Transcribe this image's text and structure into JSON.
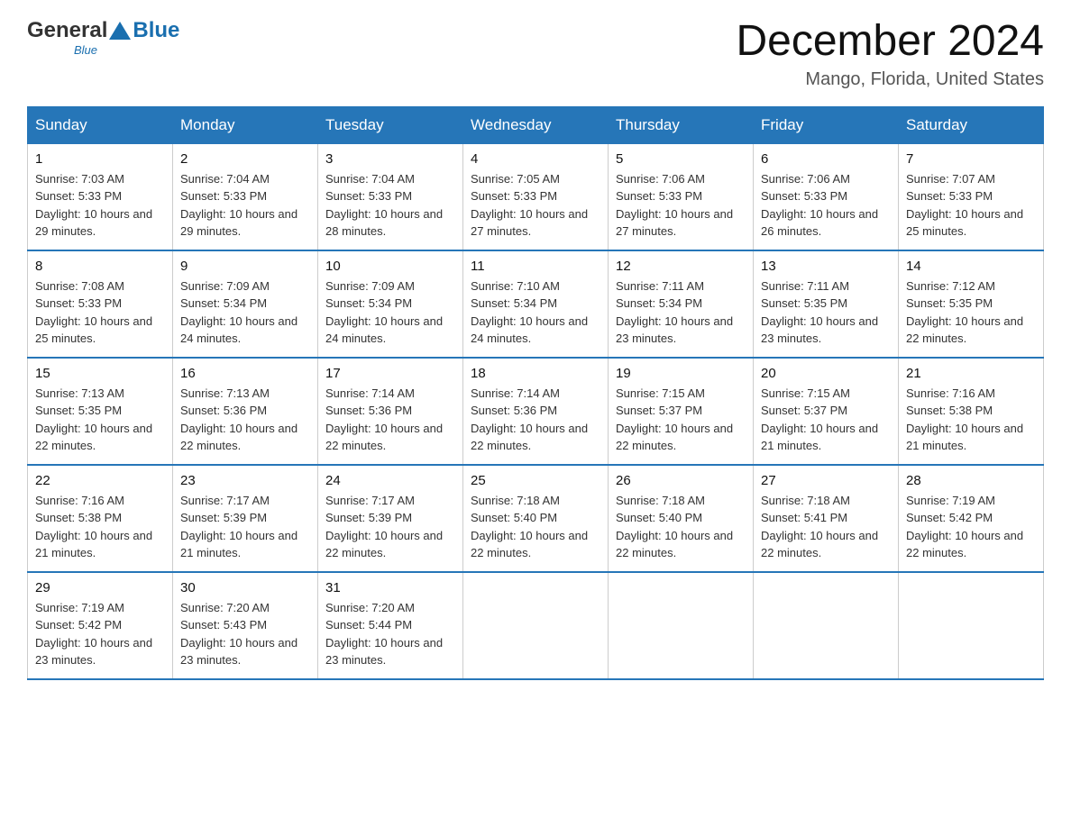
{
  "header": {
    "logo_general": "General",
    "logo_blue": "Blue",
    "month_title": "December 2024",
    "location": "Mango, Florida, United States"
  },
  "weekdays": [
    "Sunday",
    "Monday",
    "Tuesday",
    "Wednesday",
    "Thursday",
    "Friday",
    "Saturday"
  ],
  "weeks": [
    [
      {
        "day": "1",
        "sunrise": "7:03 AM",
        "sunset": "5:33 PM",
        "daylight": "10 hours and 29 minutes."
      },
      {
        "day": "2",
        "sunrise": "7:04 AM",
        "sunset": "5:33 PM",
        "daylight": "10 hours and 29 minutes."
      },
      {
        "day": "3",
        "sunrise": "7:04 AM",
        "sunset": "5:33 PM",
        "daylight": "10 hours and 28 minutes."
      },
      {
        "day": "4",
        "sunrise": "7:05 AM",
        "sunset": "5:33 PM",
        "daylight": "10 hours and 27 minutes."
      },
      {
        "day": "5",
        "sunrise": "7:06 AM",
        "sunset": "5:33 PM",
        "daylight": "10 hours and 27 minutes."
      },
      {
        "day": "6",
        "sunrise": "7:06 AM",
        "sunset": "5:33 PM",
        "daylight": "10 hours and 26 minutes."
      },
      {
        "day": "7",
        "sunrise": "7:07 AM",
        "sunset": "5:33 PM",
        "daylight": "10 hours and 25 minutes."
      }
    ],
    [
      {
        "day": "8",
        "sunrise": "7:08 AM",
        "sunset": "5:33 PM",
        "daylight": "10 hours and 25 minutes."
      },
      {
        "day": "9",
        "sunrise": "7:09 AM",
        "sunset": "5:34 PM",
        "daylight": "10 hours and 24 minutes."
      },
      {
        "day": "10",
        "sunrise": "7:09 AM",
        "sunset": "5:34 PM",
        "daylight": "10 hours and 24 minutes."
      },
      {
        "day": "11",
        "sunrise": "7:10 AM",
        "sunset": "5:34 PM",
        "daylight": "10 hours and 24 minutes."
      },
      {
        "day": "12",
        "sunrise": "7:11 AM",
        "sunset": "5:34 PM",
        "daylight": "10 hours and 23 minutes."
      },
      {
        "day": "13",
        "sunrise": "7:11 AM",
        "sunset": "5:35 PM",
        "daylight": "10 hours and 23 minutes."
      },
      {
        "day": "14",
        "sunrise": "7:12 AM",
        "sunset": "5:35 PM",
        "daylight": "10 hours and 22 minutes."
      }
    ],
    [
      {
        "day": "15",
        "sunrise": "7:13 AM",
        "sunset": "5:35 PM",
        "daylight": "10 hours and 22 minutes."
      },
      {
        "day": "16",
        "sunrise": "7:13 AM",
        "sunset": "5:36 PM",
        "daylight": "10 hours and 22 minutes."
      },
      {
        "day": "17",
        "sunrise": "7:14 AM",
        "sunset": "5:36 PM",
        "daylight": "10 hours and 22 minutes."
      },
      {
        "day": "18",
        "sunrise": "7:14 AM",
        "sunset": "5:36 PM",
        "daylight": "10 hours and 22 minutes."
      },
      {
        "day": "19",
        "sunrise": "7:15 AM",
        "sunset": "5:37 PM",
        "daylight": "10 hours and 22 minutes."
      },
      {
        "day": "20",
        "sunrise": "7:15 AM",
        "sunset": "5:37 PM",
        "daylight": "10 hours and 21 minutes."
      },
      {
        "day": "21",
        "sunrise": "7:16 AM",
        "sunset": "5:38 PM",
        "daylight": "10 hours and 21 minutes."
      }
    ],
    [
      {
        "day": "22",
        "sunrise": "7:16 AM",
        "sunset": "5:38 PM",
        "daylight": "10 hours and 21 minutes."
      },
      {
        "day": "23",
        "sunrise": "7:17 AM",
        "sunset": "5:39 PM",
        "daylight": "10 hours and 21 minutes."
      },
      {
        "day": "24",
        "sunrise": "7:17 AM",
        "sunset": "5:39 PM",
        "daylight": "10 hours and 22 minutes."
      },
      {
        "day": "25",
        "sunrise": "7:18 AM",
        "sunset": "5:40 PM",
        "daylight": "10 hours and 22 minutes."
      },
      {
        "day": "26",
        "sunrise": "7:18 AM",
        "sunset": "5:40 PM",
        "daylight": "10 hours and 22 minutes."
      },
      {
        "day": "27",
        "sunrise": "7:18 AM",
        "sunset": "5:41 PM",
        "daylight": "10 hours and 22 minutes."
      },
      {
        "day": "28",
        "sunrise": "7:19 AM",
        "sunset": "5:42 PM",
        "daylight": "10 hours and 22 minutes."
      }
    ],
    [
      {
        "day": "29",
        "sunrise": "7:19 AM",
        "sunset": "5:42 PM",
        "daylight": "10 hours and 23 minutes."
      },
      {
        "day": "30",
        "sunrise": "7:20 AM",
        "sunset": "5:43 PM",
        "daylight": "10 hours and 23 minutes."
      },
      {
        "day": "31",
        "sunrise": "7:20 AM",
        "sunset": "5:44 PM",
        "daylight": "10 hours and 23 minutes."
      },
      null,
      null,
      null,
      null
    ]
  ]
}
